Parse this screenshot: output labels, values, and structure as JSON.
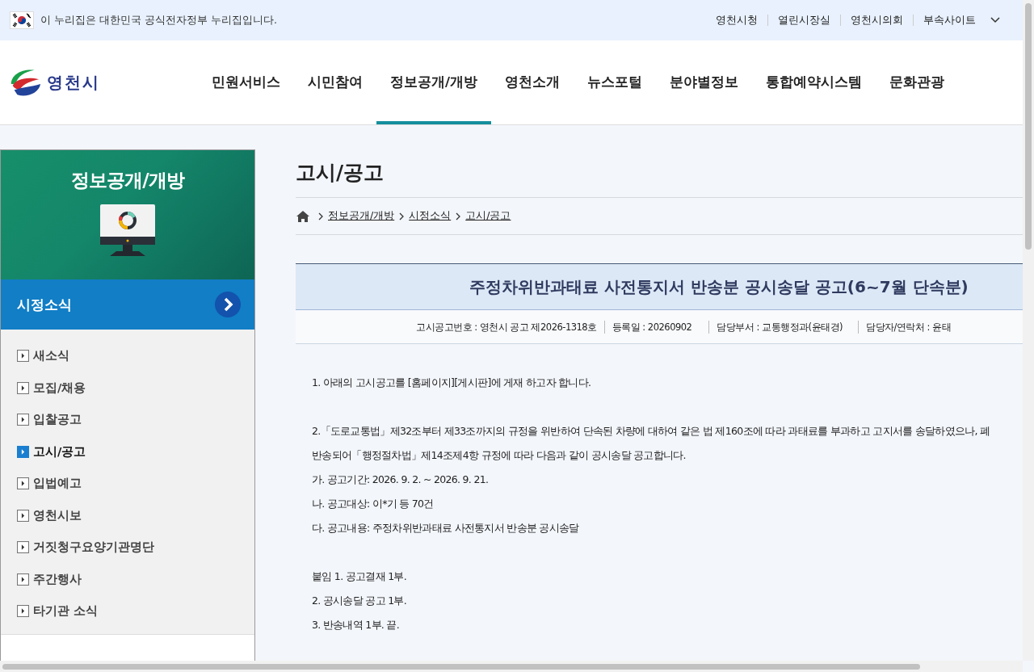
{
  "gov_banner": {
    "text": "이 누리집은 대한민국 공식전자정부 누리집입니다.",
    "links": [
      "영천시청",
      "열린시장실",
      "영천시의회",
      "부속사이트"
    ]
  },
  "logo": {
    "text": "영천시"
  },
  "nav": [
    {
      "label": "민원서비스",
      "selected": false
    },
    {
      "label": "시민참여",
      "selected": false
    },
    {
      "label": "정보공개/개방",
      "selected": true
    },
    {
      "label": "영천소개",
      "selected": false
    },
    {
      "label": "뉴스포털",
      "selected": false
    },
    {
      "label": "분야별정보",
      "selected": false
    },
    {
      "label": "통합예약시스템",
      "selected": false
    },
    {
      "label": "문화관광",
      "selected": false
    }
  ],
  "sidebar": {
    "title": "정보공개/개방",
    "section": "시정소식",
    "items": [
      {
        "label": "새소식",
        "selected": false
      },
      {
        "label": "모집/채용",
        "selected": false
      },
      {
        "label": "입찰공고",
        "selected": false
      },
      {
        "label": "고시/공고",
        "selected": true
      },
      {
        "label": "입법예고",
        "selected": false
      },
      {
        "label": "영천시보",
        "selected": false
      },
      {
        "label": "거짓청구요양기관명단",
        "selected": false
      },
      {
        "label": "주간행사",
        "selected": false
      },
      {
        "label": "타기관 소식",
        "selected": false
      }
    ]
  },
  "page_title": "고시/공고",
  "breadcrumb": [
    "정보공개/개방",
    "시정소식",
    "고시/공고"
  ],
  "notice": {
    "title": "주정차위반과태료 사전통지서 반송분 공시송달 공고(6~7월 단속분)",
    "meta": [
      "고시공고번호 : 영천시 공고 제2026-1318호",
      "등록일 : 20260902",
      "담당부서 : 교통행정과(윤태경)",
      "담당자/연락처 : 윤태"
    ],
    "body": [
      [
        "1. 아래의 고시공고를 [홈페이지][게시판]에 게재 하고자 합니다."
      ],
      [
        "2.「도로교통법」제32조부터 제33조까지의 규정을 위반하여 단속된 차량에 대하여 같은 법 제160조에 따라 과태료를 부과하고 고지서를 송달하였으나, 폐",
        "반송되어「행정절차법」제14조제4항 규정에 따라 다음과 같이 공시송달 공고합니다.",
        "가. 공고기간: 2026. 9. 2. ~ 2026. 9. 21.",
        "나. 공고대상: 이*기 등 70건",
        "다. 공고내용: 주정차위반과태료 사전통지서 반송분 공시송달"
      ],
      [
        "붙임 1. 공고결재 1부.",
        "2. 공시송달 공고 1부.",
        "3. 반송내역 1부. 끝."
      ]
    ]
  }
}
